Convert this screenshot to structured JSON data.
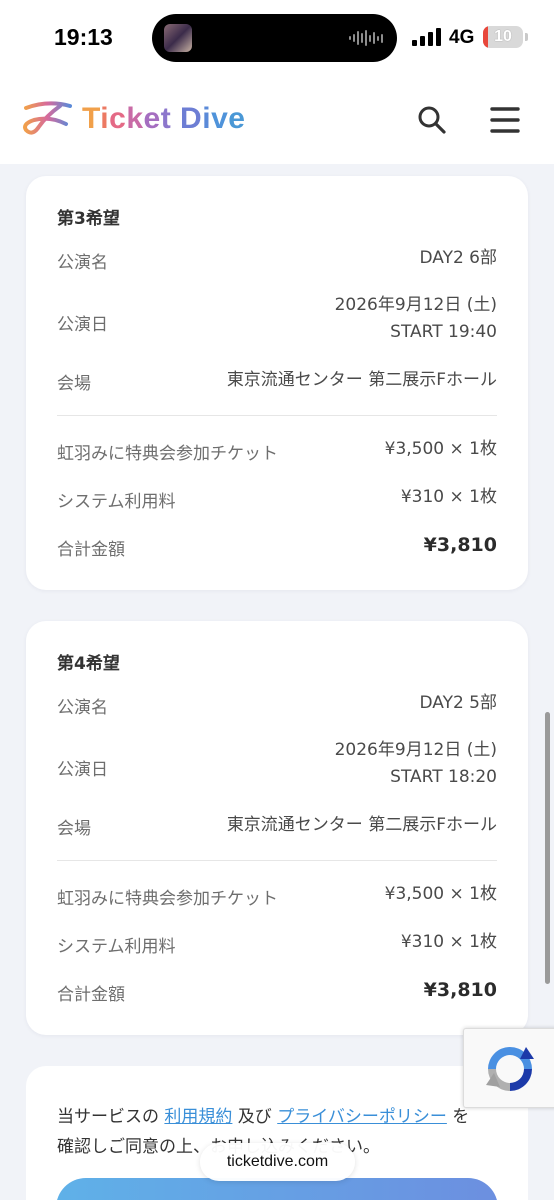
{
  "status_bar": {
    "time": "19:13",
    "network": "4G",
    "battery_level": "10"
  },
  "header": {
    "logo_text_parts": [
      "T",
      "i",
      "c",
      "k",
      "e",
      "t",
      " ",
      "D",
      "i",
      "v",
      "e"
    ],
    "logo_colors": [
      "#f1a04a",
      "#ec7a63",
      "#e46a86",
      "#c96ba6",
      "#a56ec0",
      "#8c77cc",
      "",
      "#6d7ed4",
      "#5b8ad8",
      "#4f93da",
      "#4a98d6"
    ],
    "search_icon": "search-icon",
    "menu_icon": "hamburger-menu-icon"
  },
  "cards": [
    {
      "title": "第3希望",
      "rows": {
        "performance_label": "公演名",
        "performance_value": "DAY2 6部",
        "date_label": "公演日",
        "date_value": "2026年9月12日 (土)",
        "start_value": "START 19:40",
        "venue_label": "会場",
        "venue_value": "東京流通センター 第二展示Fホール",
        "ticket_label": "虹羽みに特典会参加チケット",
        "ticket_value": "¥3,500 × 1枚",
        "fee_label": "システム利用料",
        "fee_value": "¥310 × 1枚",
        "total_label": "合計金額",
        "total_value": "¥3,810"
      }
    },
    {
      "title": "第4希望",
      "rows": {
        "performance_label": "公演名",
        "performance_value": "DAY2 5部",
        "date_label": "公演日",
        "date_value": "2026年9月12日 (土)",
        "start_value": "START 18:20",
        "venue_label": "会場",
        "venue_value": "東京流通センター 第二展示Fホール",
        "ticket_label": "虹羽みに特典会参加チケット",
        "ticket_value": "¥3,500 × 1枚",
        "fee_label": "システム利用料",
        "fee_value": "¥310 × 1枚",
        "total_label": "合計金額",
        "total_value": "¥3,810"
      }
    }
  ],
  "terms": {
    "prefix": "当サービスの ",
    "terms_link": "利用規約",
    "middle": " 及び ",
    "privacy_link": "プライバシーポリシー",
    "suffix": " を",
    "line2": "確認しご同意の上、お申し込みください。"
  },
  "browser": {
    "url": "ticketdive.com"
  },
  "colors": {
    "link": "#3a8fd8",
    "battery_low": "#e8473b",
    "page_background": "#f1f3f8"
  }
}
